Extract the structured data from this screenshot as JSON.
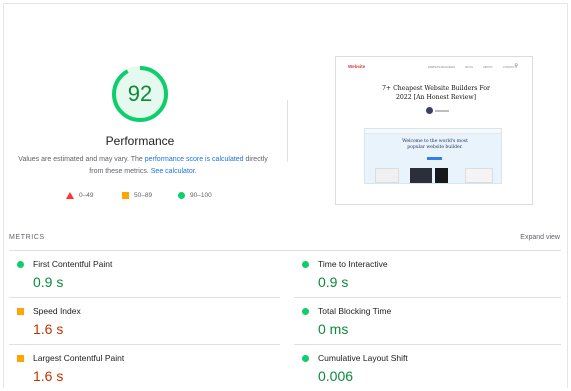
{
  "score": {
    "value": "92",
    "fraction": 0.92,
    "title": "Performance",
    "desc_prefix": "Values are estimated and may vary. The ",
    "desc_link1": "performance score is calculated",
    "desc_mid": " directly from these metrics. ",
    "desc_link2": "See calculator."
  },
  "legend": {
    "fail": "0–49",
    "average": "50–89",
    "pass": "90–100"
  },
  "screenshot": {
    "logo": "Website",
    "nav": [
      "WEBSITE BUILDERS",
      "BLOG",
      "ABOUT",
      "CONTACT"
    ],
    "headline_line1": "7+ Cheapest Website Builders For",
    "headline_line2": "2022 [An Honest Review]",
    "hero_line1": "Welcome to the world's most",
    "hero_line2": "popular website builder."
  },
  "metrics": {
    "label": "METRICS",
    "expand_label": "Expand view",
    "items": [
      {
        "name": "First Contentful Paint",
        "value": "0.9 s",
        "status": "pass"
      },
      {
        "name": "Time to Interactive",
        "value": "0.9 s",
        "status": "pass"
      },
      {
        "name": "Speed Index",
        "value": "1.6 s",
        "status": "average"
      },
      {
        "name": "Total Blocking Time",
        "value": "0 ms",
        "status": "pass"
      },
      {
        "name": "Largest Contentful Paint",
        "value": "1.6 s",
        "status": "average"
      },
      {
        "name": "Cumulative Layout Shift",
        "value": "0.006",
        "status": "pass"
      }
    ]
  },
  "colors": {
    "pass": "#0cce6b",
    "pass_text": "#0c8a3a",
    "average": "#ffa400",
    "average_text": "#c33300",
    "fail": "#ff3333",
    "link": "#1a73e8"
  }
}
